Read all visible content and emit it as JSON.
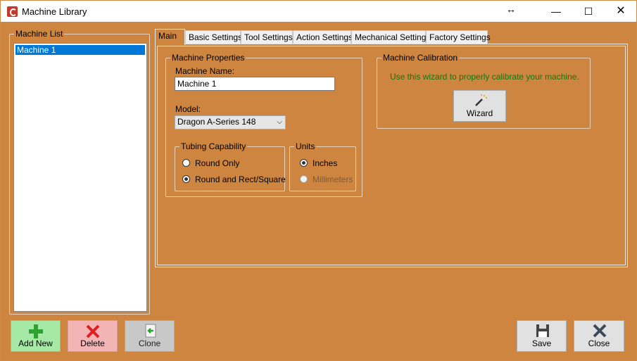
{
  "window": {
    "title": "Machine Library",
    "resize_glyph": "↔",
    "min_glyph": "—",
    "max_glyph": "☐",
    "close_glyph": "✕"
  },
  "machine_list": {
    "title": "Machine List",
    "items": [
      {
        "label": "Machine 1",
        "selected": true
      }
    ]
  },
  "tabs": [
    {
      "label": "Main",
      "active": true
    },
    {
      "label": "Basic Settings"
    },
    {
      "label": "Tool Settings"
    },
    {
      "label": "Action Settings"
    },
    {
      "label": "Mechanical Settings"
    },
    {
      "label": "Factory Settings"
    }
  ],
  "machine_properties": {
    "title": "Machine Properties",
    "name_label": "Machine Name:",
    "name_value": "Machine 1",
    "model_label": "Model:",
    "model_value": "Dragon A-Series 148",
    "tubing": {
      "title": "Tubing Capability",
      "options": [
        "Round Only",
        "Round and Rect/Square"
      ],
      "selected": "Round and Rect/Square"
    },
    "units": {
      "title": "Units",
      "options": [
        "Inches",
        "Millimeters"
      ],
      "selected": "Inches",
      "disabled": "Millimeters"
    }
  },
  "calibration": {
    "title": "Machine Calibration",
    "hint": "Use this wizard to properly calibrate your machine.",
    "wizard_label": "Wizard"
  },
  "footer": {
    "add_label": "Add New",
    "delete_label": "Delete",
    "clone_label": "Clone",
    "save_label": "Save",
    "close_label": "Close"
  },
  "colors": {
    "background": "#cd853f",
    "selection": "#0078d7",
    "hint_text": "#0b7a10",
    "add": "#a6e8a6",
    "delete": "#f2b4b4"
  },
  "icons": [
    "app-icon",
    "wand-icon",
    "plus-icon",
    "x-icon",
    "clone-icon",
    "floppy-icon",
    "close-x-icon"
  ]
}
